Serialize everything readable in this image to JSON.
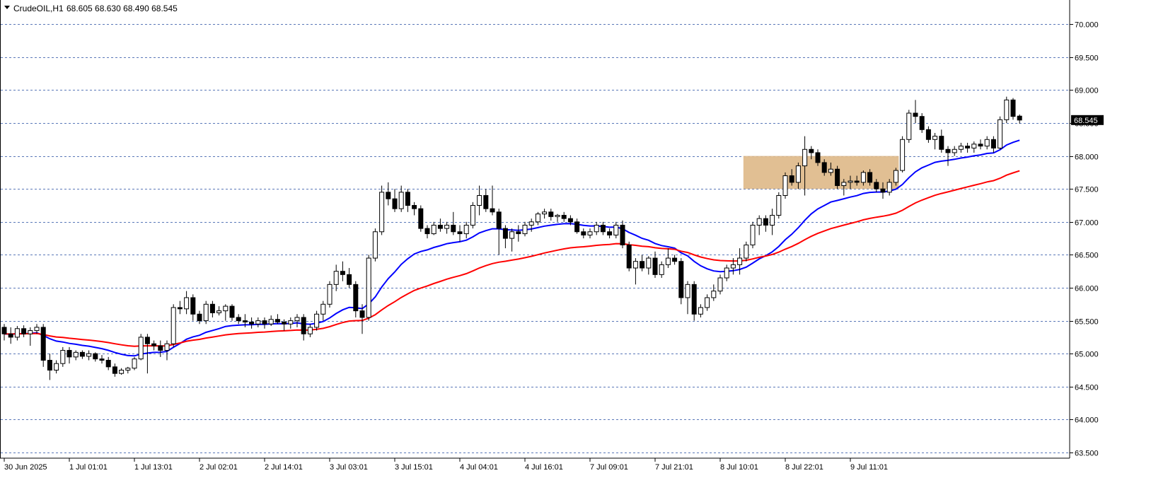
{
  "header": {
    "symbol": "CrudeOIL,H1",
    "ohlc": "68.605 68.630 68.490 68.545"
  },
  "colors": {
    "bull_fill": "#ffffff",
    "bear_fill": "#000000",
    "wick": "#000000",
    "ema_fast": "#0000ff",
    "ema_slow": "#ff0000",
    "grid": "#5a78b8",
    "zone": "#deb887",
    "axis": "#000000"
  },
  "chart_data": {
    "type": "candlestick",
    "timeframe": "H1",
    "ylim": [
      63.5,
      70.3
    ],
    "y_ticks": [
      70.0,
      69.5,
      69.0,
      68.5,
      68.0,
      67.5,
      67.0,
      66.5,
      66.0,
      65.5,
      65.0,
      64.5,
      64.0,
      63.5
    ],
    "y_tick_labels": [
      "70.000",
      "69.500",
      "69.000",
      "68.500",
      "68.000",
      "67.500",
      "67.000",
      "66.500",
      "66.000",
      "65.500",
      "65.000",
      "64.500",
      "64.000",
      "63.500"
    ],
    "current_price_label": "68.545",
    "x_labels": [
      {
        "index": 0,
        "label": "30 Jun 2025"
      },
      {
        "index": 10,
        "label": "1 Jul 01:01"
      },
      {
        "index": 20,
        "label": "1 Jul 13:01"
      },
      {
        "index": 30,
        "label": "2 Jul 02:01"
      },
      {
        "index": 40,
        "label": "2 Jul 14:01"
      },
      {
        "index": 50,
        "label": "3 Jul 03:01"
      },
      {
        "index": 60,
        "label": "3 Jul 15:01"
      },
      {
        "index": 70,
        "label": "4 Jul 04:01"
      },
      {
        "index": 80,
        "label": "4 Jul 16:01"
      },
      {
        "index": 90,
        "label": "7 Jul 09:01"
      },
      {
        "index": 100,
        "label": "7 Jul 21:01"
      },
      {
        "index": 110,
        "label": "8 Jul 10:01"
      },
      {
        "index": 120,
        "label": "8 Jul 22:01"
      },
      {
        "index": 130,
        "label": "9 Jul 11:01"
      }
    ],
    "zone": {
      "from_index": 114,
      "to_index": 137,
      "low": 67.5,
      "high": 68.0
    },
    "ohlc": [
      [
        65.4,
        65.45,
        65.2,
        65.3
      ],
      [
        65.3,
        65.4,
        65.15,
        65.25
      ],
      [
        65.25,
        65.42,
        65.2,
        65.38
      ],
      [
        65.38,
        65.43,
        65.25,
        65.3
      ],
      [
        65.3,
        65.4,
        65.12,
        65.35
      ],
      [
        65.35,
        65.45,
        65.3,
        65.4
      ],
      [
        65.4,
        65.45,
        64.8,
        64.9
      ],
      [
        64.9,
        65.0,
        64.6,
        64.75
      ],
      [
        64.75,
        64.9,
        64.7,
        64.85
      ],
      [
        64.85,
        65.1,
        64.8,
        65.05
      ],
      [
        65.05,
        65.1,
        64.85,
        64.95
      ],
      [
        64.95,
        65.05,
        64.9,
        65.02
      ],
      [
        65.02,
        65.05,
        64.92,
        64.96
      ],
      [
        64.96,
        65.05,
        64.9,
        65.0
      ],
      [
        65.0,
        65.02,
        64.88,
        64.92
      ],
      [
        64.92,
        64.98,
        64.85,
        64.9
      ],
      [
        64.9,
        64.95,
        64.75,
        64.8
      ],
      [
        64.8,
        64.85,
        64.65,
        64.7
      ],
      [
        64.7,
        64.78,
        64.68,
        64.75
      ],
      [
        64.75,
        64.8,
        64.7,
        64.78
      ],
      [
        64.78,
        64.95,
        64.75,
        64.92
      ],
      [
        64.92,
        65.3,
        64.9,
        65.25
      ],
      [
        65.25,
        65.3,
        64.7,
        65.15
      ],
      [
        65.15,
        65.2,
        65.05,
        65.12
      ],
      [
        65.12,
        65.2,
        64.95,
        65.05
      ],
      [
        65.05,
        65.2,
        64.9,
        65.15
      ],
      [
        65.15,
        65.75,
        65.1,
        65.7
      ],
      [
        65.7,
        65.8,
        65.6,
        65.68
      ],
      [
        65.68,
        65.95,
        65.6,
        65.85
      ],
      [
        65.85,
        65.9,
        65.5,
        65.6
      ],
      [
        65.6,
        65.65,
        65.45,
        65.5
      ],
      [
        65.5,
        65.8,
        65.45,
        65.75
      ],
      [
        65.75,
        65.8,
        65.55,
        65.62
      ],
      [
        65.62,
        65.72,
        65.58,
        65.65
      ],
      [
        65.65,
        65.75,
        65.5,
        65.72
      ],
      [
        65.72,
        65.75,
        65.5,
        65.55
      ],
      [
        65.55,
        65.6,
        65.45,
        65.5
      ],
      [
        65.5,
        65.6,
        65.4,
        65.48
      ],
      [
        65.48,
        65.55,
        65.38,
        65.45
      ],
      [
        65.45,
        65.55,
        65.4,
        65.5
      ],
      [
        65.5,
        65.55,
        65.38,
        65.45
      ],
      [
        65.45,
        65.58,
        65.42,
        65.52
      ],
      [
        65.52,
        65.6,
        65.45,
        65.48
      ],
      [
        65.48,
        65.52,
        65.35,
        65.45
      ],
      [
        65.45,
        65.55,
        65.38,
        65.5
      ],
      [
        65.5,
        65.6,
        65.4,
        65.55
      ],
      [
        65.55,
        65.6,
        65.2,
        65.3
      ],
      [
        65.3,
        65.45,
        65.25,
        65.4
      ],
      [
        65.4,
        65.65,
        65.35,
        65.6
      ],
      [
        65.6,
        65.8,
        65.5,
        65.75
      ],
      [
        65.75,
        66.1,
        65.7,
        66.05
      ],
      [
        66.05,
        66.35,
        65.95,
        66.25
      ],
      [
        66.25,
        66.4,
        66.1,
        66.2
      ],
      [
        66.2,
        66.3,
        66.0,
        66.05
      ],
      [
        66.05,
        66.1,
        65.55,
        65.65
      ],
      [
        65.65,
        65.75,
        65.3,
        65.55
      ],
      [
        65.55,
        66.5,
        65.5,
        66.45
      ],
      [
        66.45,
        66.9,
        66.4,
        66.85
      ],
      [
        66.85,
        67.55,
        66.8,
        67.45
      ],
      [
        67.45,
        67.6,
        67.25,
        67.35
      ],
      [
        67.35,
        67.5,
        67.15,
        67.2
      ],
      [
        67.2,
        67.55,
        67.15,
        67.45
      ],
      [
        67.45,
        67.5,
        67.15,
        67.25
      ],
      [
        67.25,
        67.3,
        67.1,
        67.2
      ],
      [
        67.2,
        67.25,
        66.85,
        66.9
      ],
      [
        66.9,
        66.95,
        66.75,
        66.82
      ],
      [
        66.82,
        67.0,
        66.8,
        66.95
      ],
      [
        66.95,
        67.05,
        66.85,
        66.9
      ],
      [
        66.9,
        67.0,
        66.82,
        66.95
      ],
      [
        66.95,
        67.15,
        66.8,
        66.85
      ],
      [
        66.85,
        66.95,
        66.7,
        66.82
      ],
      [
        66.82,
        67.0,
        66.75,
        66.95
      ],
      [
        66.95,
        67.3,
        66.9,
        67.25
      ],
      [
        67.25,
        67.55,
        67.1,
        67.4
      ],
      [
        67.4,
        67.5,
        67.15,
        67.2
      ],
      [
        67.2,
        67.55,
        67.1,
        67.15
      ],
      [
        67.15,
        67.2,
        66.5,
        66.9
      ],
      [
        66.9,
        66.95,
        66.6,
        66.75
      ],
      [
        66.75,
        66.9,
        66.55,
        66.85
      ],
      [
        66.85,
        66.95,
        66.7,
        66.82
      ],
      [
        66.82,
        67.0,
        66.78,
        66.95
      ],
      [
        66.95,
        67.05,
        66.85,
        67.0
      ],
      [
        67.0,
        67.15,
        66.95,
        67.12
      ],
      [
        67.12,
        67.2,
        67.05,
        67.15
      ],
      [
        67.15,
        67.2,
        67.02,
        67.08
      ],
      [
        67.08,
        67.12,
        67.0,
        67.1
      ],
      [
        67.1,
        67.15,
        67.0,
        67.05
      ],
      [
        67.05,
        67.1,
        66.95,
        67.0
      ],
      [
        67.0,
        67.05,
        66.82,
        66.85
      ],
      [
        66.85,
        66.9,
        66.75,
        66.8
      ],
      [
        66.8,
        66.9,
        66.75,
        66.85
      ],
      [
        66.85,
        67.0,
        66.8,
        66.95
      ],
      [
        66.95,
        67.0,
        66.8,
        66.85
      ],
      [
        66.85,
        66.9,
        66.75,
        66.8
      ],
      [
        66.8,
        67.0,
        66.75,
        66.95
      ],
      [
        66.95,
        67.02,
        66.6,
        66.65
      ],
      [
        66.65,
        66.7,
        66.25,
        66.3
      ],
      [
        66.3,
        66.45,
        66.05,
        66.4
      ],
      [
        66.4,
        66.5,
        66.25,
        66.3
      ],
      [
        66.3,
        66.48,
        66.2,
        66.45
      ],
      [
        66.45,
        66.55,
        66.15,
        66.2
      ],
      [
        66.2,
        66.4,
        66.15,
        66.35
      ],
      [
        66.35,
        66.6,
        66.3,
        66.45
      ],
      [
        66.45,
        66.5,
        66.35,
        66.4
      ],
      [
        66.4,
        66.45,
        65.75,
        65.85
      ],
      [
        65.85,
        66.1,
        65.6,
        66.05
      ],
      [
        66.05,
        66.1,
        65.5,
        65.6
      ],
      [
        65.6,
        65.75,
        65.55,
        65.7
      ],
      [
        65.7,
        65.9,
        65.65,
        65.85
      ],
      [
        65.85,
        66.05,
        65.8,
        65.95
      ],
      [
        65.95,
        66.2,
        65.9,
        66.15
      ],
      [
        66.15,
        66.35,
        66.1,
        66.3
      ],
      [
        66.3,
        66.45,
        66.2,
        66.35
      ],
      [
        66.35,
        66.6,
        66.2,
        66.45
      ],
      [
        66.45,
        66.7,
        66.4,
        66.65
      ],
      [
        66.65,
        67.0,
        66.6,
        66.95
      ],
      [
        66.95,
        67.1,
        66.8,
        67.05
      ],
      [
        67.05,
        67.1,
        66.85,
        66.95
      ],
      [
        66.95,
        67.2,
        66.8,
        67.1
      ],
      [
        67.1,
        67.45,
        67.05,
        67.4
      ],
      [
        67.4,
        67.75,
        67.35,
        67.7
      ],
      [
        67.7,
        67.8,
        67.55,
        67.6
      ],
      [
        67.6,
        67.9,
        67.5,
        67.85
      ],
      [
        67.85,
        68.3,
        67.4,
        68.1
      ],
      [
        68.1,
        68.15,
        67.95,
        68.05
      ],
      [
        68.05,
        68.1,
        67.85,
        67.9
      ],
      [
        67.9,
        67.95,
        67.7,
        67.75
      ],
      [
        67.75,
        67.9,
        67.7,
        67.8
      ],
      [
        67.8,
        67.85,
        67.5,
        67.55
      ],
      [
        67.55,
        67.65,
        67.4,
        67.6
      ],
      [
        67.6,
        67.7,
        67.5,
        67.62
      ],
      [
        67.62,
        67.7,
        67.55,
        67.6
      ],
      [
        67.6,
        67.78,
        67.55,
        67.75
      ],
      [
        67.75,
        67.8,
        67.55,
        67.6
      ],
      [
        67.6,
        67.65,
        67.45,
        67.5
      ],
      [
        67.5,
        67.6,
        67.35,
        67.45
      ],
      [
        67.45,
        67.65,
        67.4,
        67.6
      ],
      [
        67.6,
        67.82,
        67.55,
        67.78
      ],
      [
        67.78,
        68.3,
        67.75,
        68.25
      ],
      [
        68.25,
        68.7,
        68.2,
        68.65
      ],
      [
        68.65,
        68.85,
        68.5,
        68.6
      ],
      [
        68.6,
        68.65,
        68.35,
        68.4
      ],
      [
        68.4,
        68.45,
        68.2,
        68.25
      ],
      [
        68.25,
        68.35,
        68.1,
        68.3
      ],
      [
        68.3,
        68.4,
        68.05,
        68.1
      ],
      [
        68.1,
        68.15,
        67.85,
        68.05
      ],
      [
        68.05,
        68.15,
        68.0,
        68.1
      ],
      [
        68.1,
        68.2,
        68.05,
        68.15
      ],
      [
        68.15,
        68.2,
        68.05,
        68.12
      ],
      [
        68.12,
        68.22,
        68.05,
        68.18
      ],
      [
        68.18,
        68.25,
        68.1,
        68.15
      ],
      [
        68.15,
        68.3,
        68.1,
        68.25
      ],
      [
        68.25,
        68.3,
        68.05,
        68.12
      ],
      [
        68.12,
        68.6,
        68.1,
        68.55
      ],
      [
        68.55,
        68.9,
        68.5,
        68.85
      ],
      [
        68.85,
        68.88,
        68.55,
        68.6
      ],
      [
        68.605,
        68.63,
        68.49,
        68.545
      ]
    ]
  }
}
